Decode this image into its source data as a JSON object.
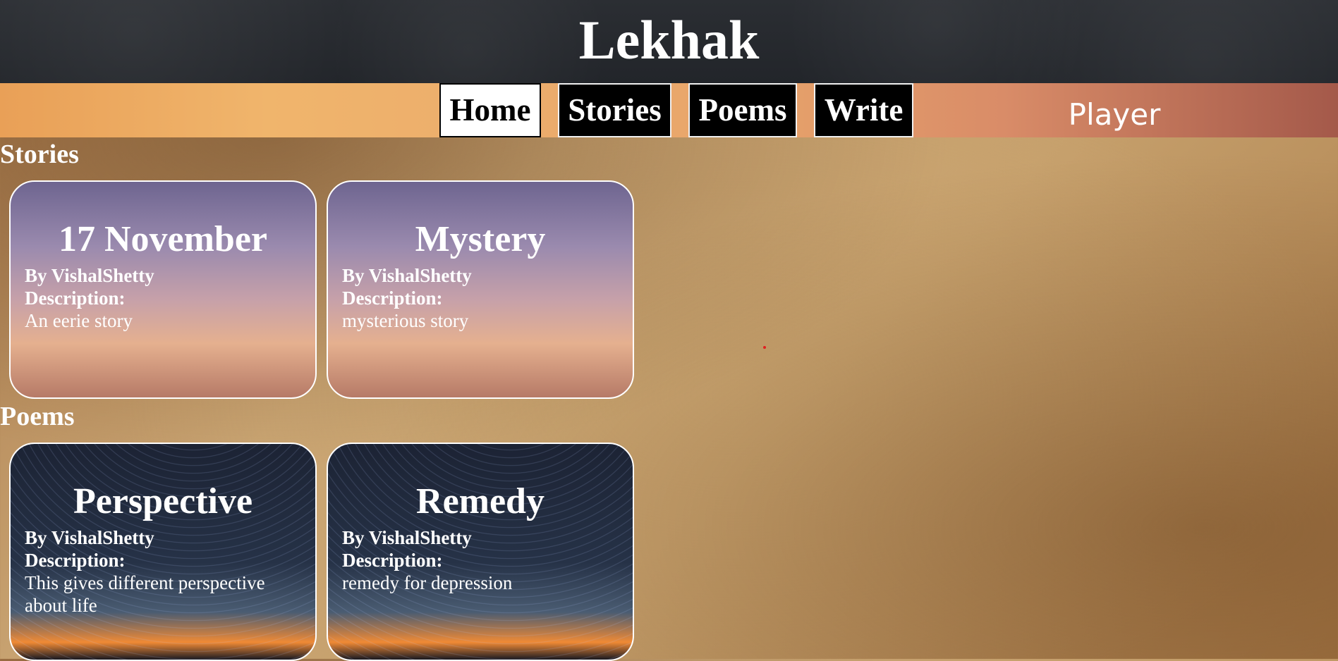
{
  "site": {
    "title": "Lekhak"
  },
  "nav": {
    "items": [
      {
        "label": "Home",
        "active": true
      },
      {
        "label": "Stories",
        "active": false
      },
      {
        "label": "Poems",
        "active": false
      },
      {
        "label": "Write",
        "active": false
      }
    ],
    "player_label": "Player"
  },
  "sections": {
    "stories": {
      "heading": "Stories",
      "cards": [
        {
          "title": "17 November",
          "author": "By VishalShetty",
          "desc_label": "Description:",
          "desc": "An eerie story"
        },
        {
          "title": "Mystery",
          "author": "By VishalShetty",
          "desc_label": "Description:",
          "desc": "mysterious story"
        }
      ]
    },
    "poems": {
      "heading": "Poems",
      "cards": [
        {
          "title": "Perspective",
          "author": "By VishalShetty",
          "desc_label": "Description:",
          "desc": "This gives different perspective about life"
        },
        {
          "title": "Remedy",
          "author": "By VishalShetty",
          "desc_label": "Description:",
          "desc": "remedy for depression"
        }
      ]
    }
  },
  "colors": {
    "header_bg": "#2b2e33",
    "nav_active_bg": "#ffffff",
    "nav_bg": "#000000",
    "text": "#ffffff"
  }
}
